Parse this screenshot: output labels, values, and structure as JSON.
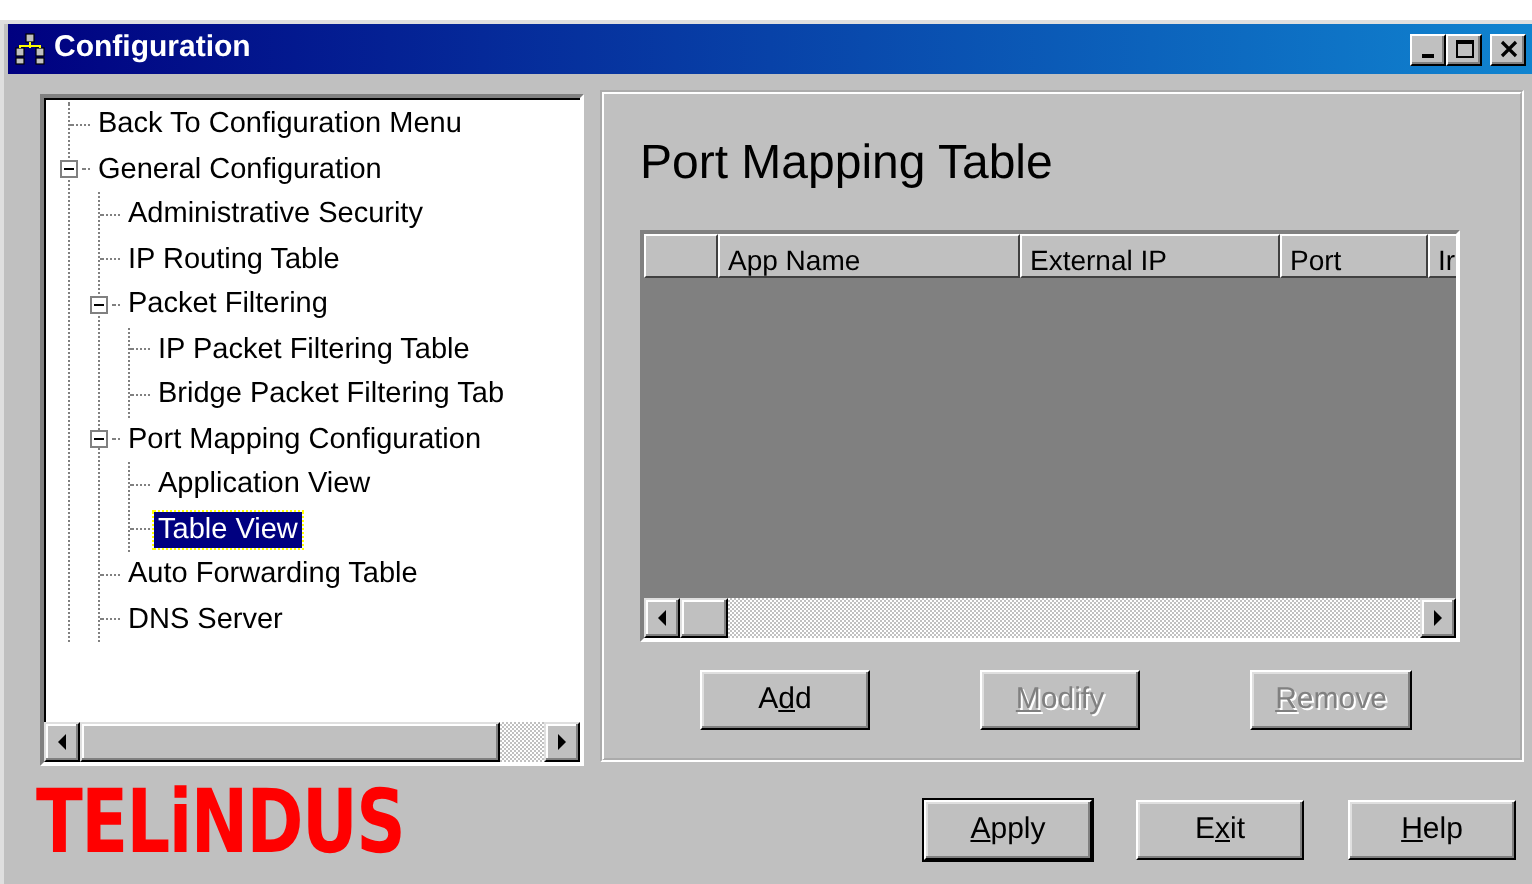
{
  "window": {
    "title": "Configuration"
  },
  "tree": [
    {
      "label": "Back To Configuration Menu",
      "selected": false
    },
    {
      "label": "General Configuration",
      "selected": false,
      "expanded": true,
      "children": [
        {
          "label": "Administrative Security",
          "selected": false
        },
        {
          "label": "IP Routing Table",
          "selected": false
        },
        {
          "label": "Packet Filtering",
          "selected": false,
          "expanded": true,
          "children": [
            {
              "label": "IP Packet Filtering Table",
              "selected": false
            },
            {
              "label": "Bridge Packet Filtering Tab",
              "selected": false
            }
          ]
        },
        {
          "label": "Port Mapping Configuration",
          "selected": false,
          "expanded": true,
          "children": [
            {
              "label": "Application View",
              "selected": false
            },
            {
              "label": "Table View",
              "selected": true
            }
          ]
        },
        {
          "label": "Auto Forwarding Table",
          "selected": false
        },
        {
          "label": "DNS Server",
          "selected": false
        }
      ]
    }
  ],
  "panel": {
    "title": "Port Mapping Table",
    "table": {
      "columns": [
        "App Name",
        "External IP",
        "Port",
        "Ir"
      ]
    },
    "buttons": [
      {
        "pre": "A",
        "key": "d",
        "post": "d",
        "disabled": false
      },
      {
        "key": "M",
        "post": "odify",
        "disabled": true
      },
      {
        "key": "R",
        "post": "emove",
        "disabled": true
      }
    ]
  },
  "logo": {
    "text": "TELiNDUS"
  },
  "footer_buttons": [
    {
      "key": "A",
      "post": "pply",
      "default": true
    },
    {
      "pre": "E",
      "key": "x",
      "post": "it",
      "default": false
    },
    {
      "key": "H",
      "post": "elp",
      "default": false
    }
  ]
}
